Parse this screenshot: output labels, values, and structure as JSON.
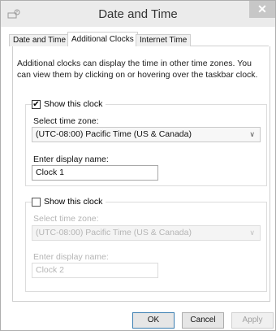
{
  "window": {
    "title": "Date and Time",
    "close_glyph": "✕"
  },
  "tabs": [
    {
      "label": "Date and Time",
      "active": false
    },
    {
      "label": "Additional Clocks",
      "active": true
    },
    {
      "label": "Internet Time",
      "active": false
    }
  ],
  "intro_text": "Additional clocks can display the time in other time zones. You can view them by clicking on or hovering over the taskbar clock.",
  "clock1": {
    "checkbox_label": "Show this clock",
    "checked": true,
    "timezone_label": "Select time zone:",
    "timezone_value": "(UTC-08:00) Pacific Time (US & Canada)",
    "name_label": "Enter display name:",
    "name_value": "Clock 1"
  },
  "clock2": {
    "checkbox_label": "Show this clock",
    "checked": false,
    "timezone_label": "Select time zone:",
    "timezone_value": "(UTC-08:00) Pacific Time (US & Canada)",
    "name_label": "Enter display name:",
    "name_value": "Clock 2"
  },
  "buttons": {
    "ok": "OK",
    "cancel": "Cancel",
    "apply": "Apply"
  },
  "icons": {
    "app": "clock-settings-icon",
    "close": "close-icon",
    "dropdown": "chevron-down-icon",
    "check": "checkmark-icon"
  },
  "colors": {
    "titlebar": "#ebebeb",
    "close_button": "#c7c7c7",
    "ok_border": "#3c7fb1",
    "disabled_text": "#b5b5b5"
  }
}
